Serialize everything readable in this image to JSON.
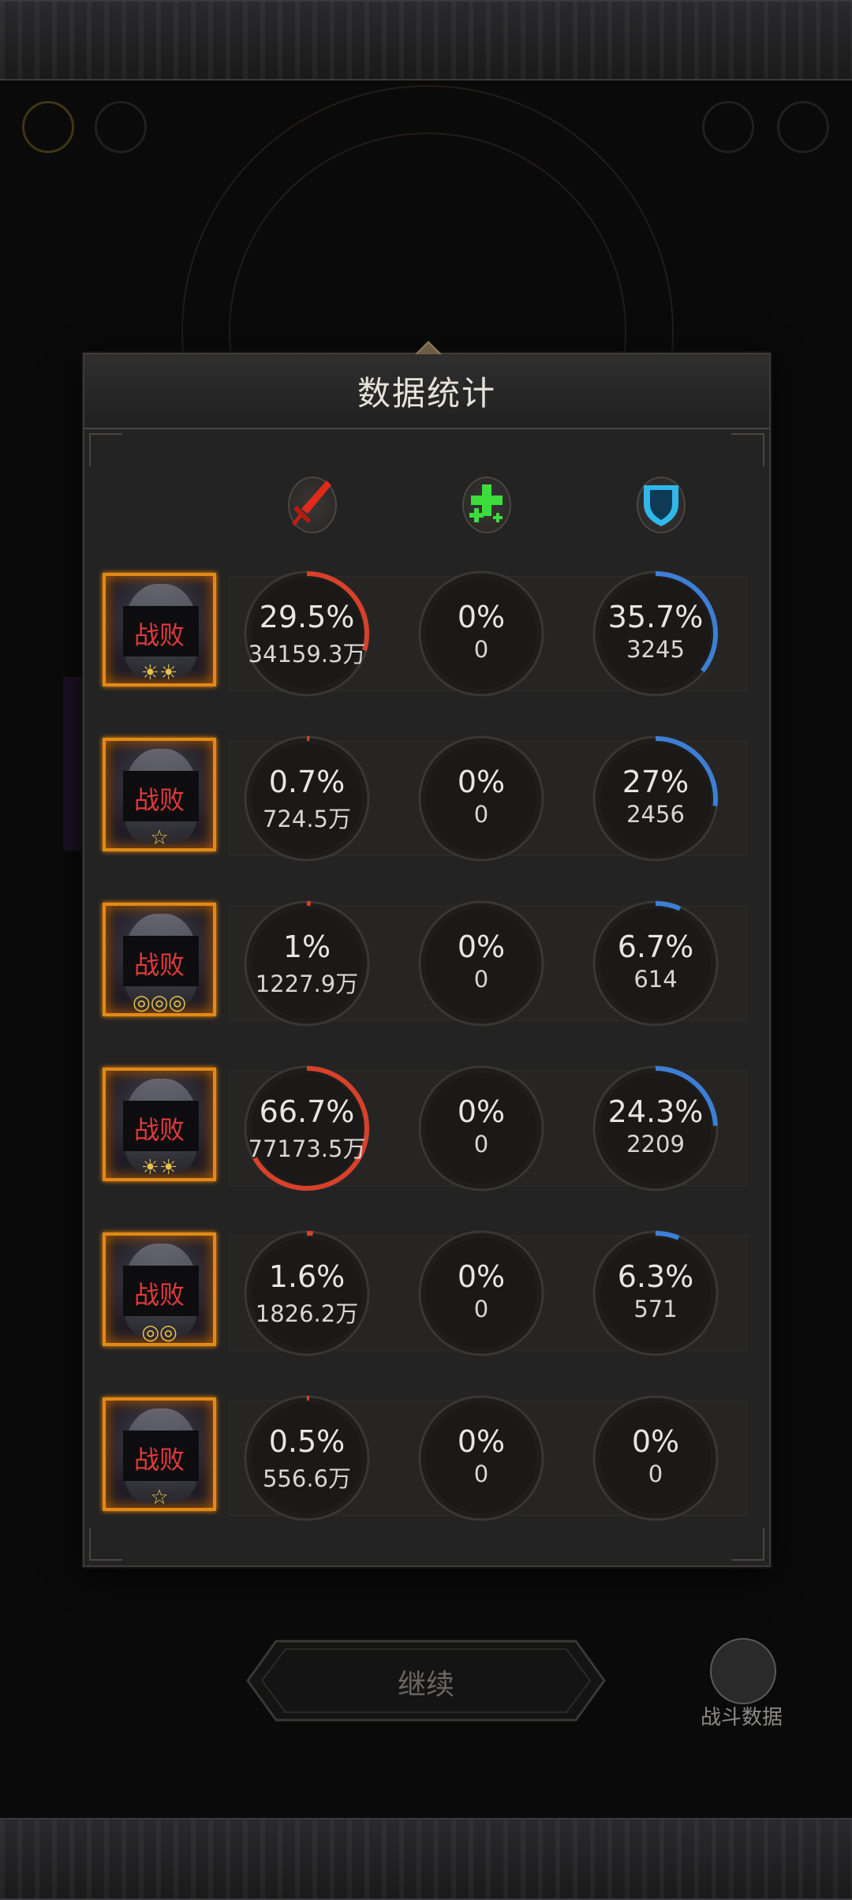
{
  "dialog": {
    "title": "数据统计"
  },
  "columns": [
    {
      "icon": "sword-damage-icon",
      "color": "#e23020"
    },
    {
      "icon": "heal-plus-icon",
      "color": "#3ddc3d"
    },
    {
      "icon": "shield-defense-icon",
      "color": "#2fb8e8"
    }
  ],
  "colors": {
    "damage": "#d9402a",
    "heal": "#3ddc3d",
    "defense": "#3d7fd6",
    "status": "#e23a3a",
    "frame": "#e08a18"
  },
  "rows": [
    {
      "status": "战败",
      "stars": "☀☀",
      "damage": {
        "pct": "29.5%",
        "value": "34159.3万",
        "frac": 0.295
      },
      "heal": {
        "pct": "0%",
        "value": "0",
        "frac": 0
      },
      "defense": {
        "pct": "35.7%",
        "value": "3245",
        "frac": 0.357
      }
    },
    {
      "status": "战败",
      "stars": "☆",
      "damage": {
        "pct": "0.7%",
        "value": "724.5万",
        "frac": 0.007
      },
      "heal": {
        "pct": "0%",
        "value": "0",
        "frac": 0
      },
      "defense": {
        "pct": "27%",
        "value": "2456",
        "frac": 0.27
      }
    },
    {
      "status": "战败",
      "stars": "◎◎◎",
      "damage": {
        "pct": "1%",
        "value": "1227.9万",
        "frac": 0.01
      },
      "heal": {
        "pct": "0%",
        "value": "0",
        "frac": 0
      },
      "defense": {
        "pct": "6.7%",
        "value": "614",
        "frac": 0.067
      }
    },
    {
      "status": "战败",
      "stars": "☀☀",
      "damage": {
        "pct": "66.7%",
        "value": "77173.5万",
        "frac": 0.667
      },
      "heal": {
        "pct": "0%",
        "value": "0",
        "frac": 0
      },
      "defense": {
        "pct": "24.3%",
        "value": "2209",
        "frac": 0.243
      }
    },
    {
      "status": "战败",
      "stars": "◎◎",
      "damage": {
        "pct": "1.6%",
        "value": "1826.2万",
        "frac": 0.016
      },
      "heal": {
        "pct": "0%",
        "value": "0",
        "frac": 0
      },
      "defense": {
        "pct": "6.3%",
        "value": "571",
        "frac": 0.063
      }
    },
    {
      "status": "战败",
      "stars": "☆",
      "damage": {
        "pct": "0.5%",
        "value": "556.6万",
        "frac": 0.005
      },
      "heal": {
        "pct": "0%",
        "value": "0",
        "frac": 0
      },
      "defense": {
        "pct": "0%",
        "value": "0",
        "frac": 0
      }
    }
  ],
  "footer": {
    "continue_label": "继续",
    "battle_data_label": "战斗数据"
  }
}
